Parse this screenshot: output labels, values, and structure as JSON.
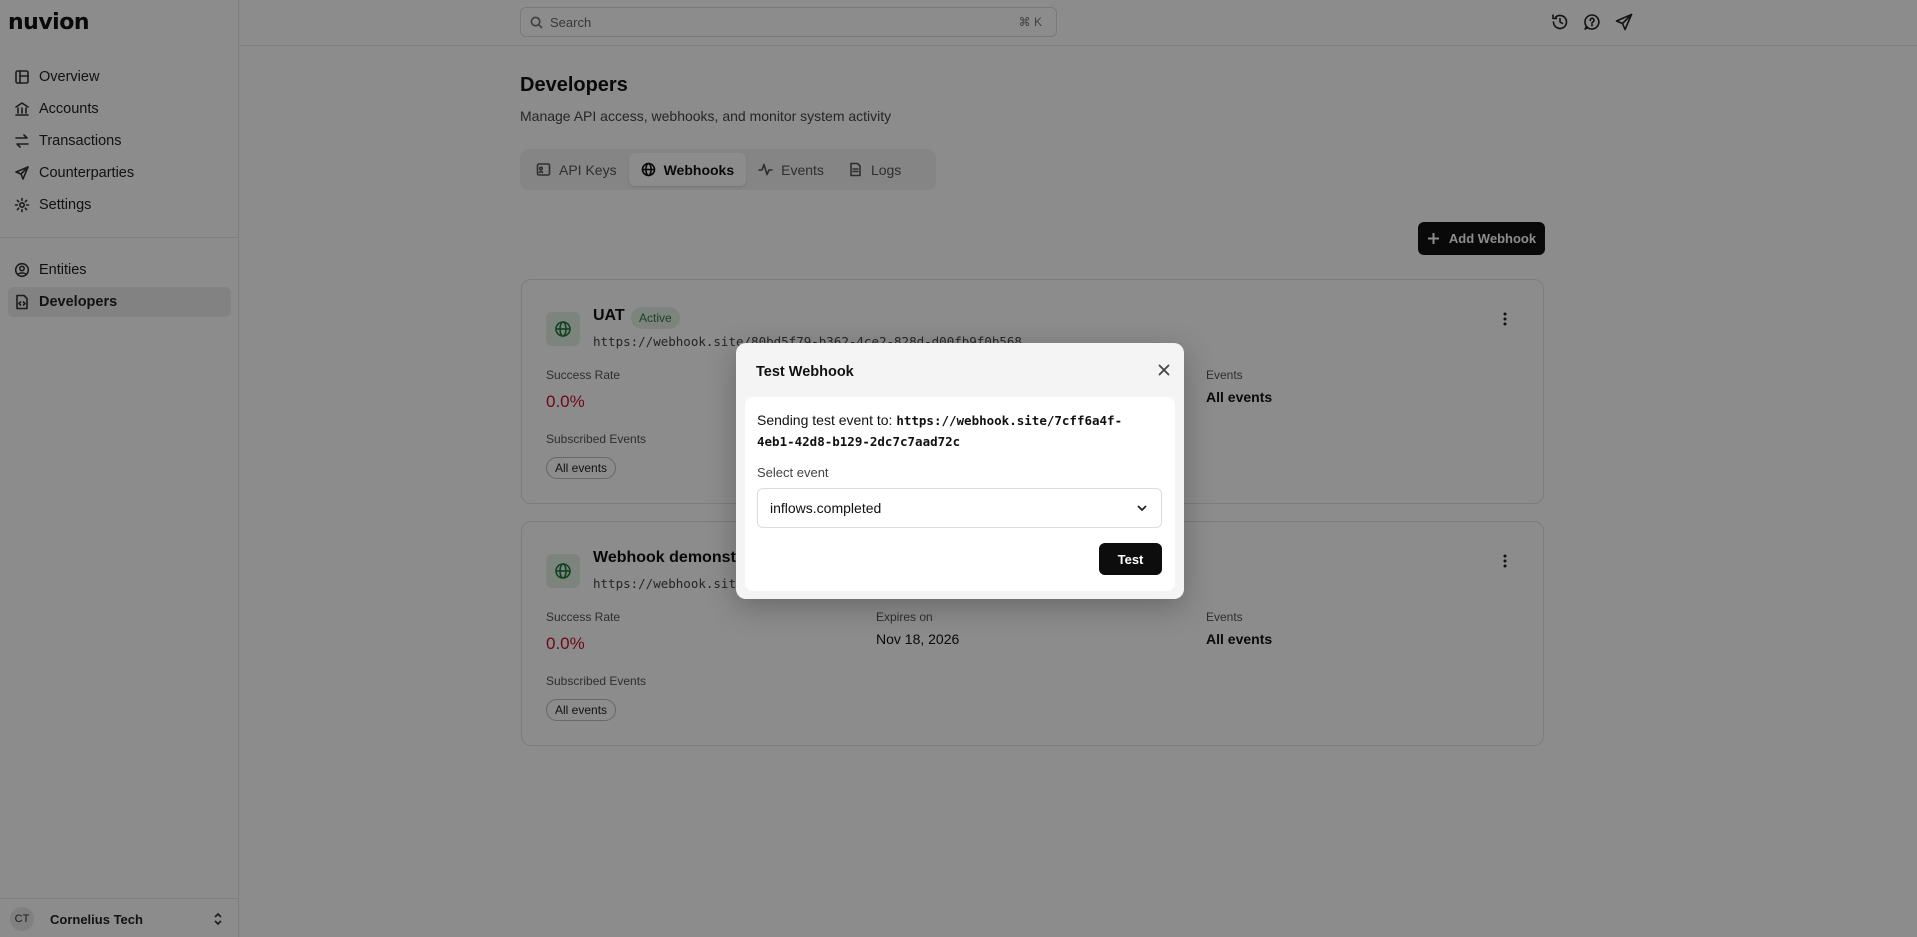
{
  "app": {
    "logo": "nuvion"
  },
  "sidebar": {
    "primary": [
      {
        "label": "Overview",
        "icon": "layout-icon"
      },
      {
        "label": "Accounts",
        "icon": "bank-icon"
      },
      {
        "label": "Transactions",
        "icon": "arrows-icon"
      },
      {
        "label": "Counterparties",
        "icon": "send-icon"
      },
      {
        "label": "Settings",
        "icon": "gear-icon"
      }
    ],
    "secondary": [
      {
        "label": "Entities",
        "icon": "user-circle-icon"
      },
      {
        "label": "Developers",
        "icon": "code-file-icon",
        "active": true
      }
    ],
    "account": {
      "initials": "CT",
      "name": "Cornelius Tech"
    }
  },
  "topbar": {
    "search_placeholder": "Search",
    "search_shortcut": "⌘ K"
  },
  "page": {
    "title": "Developers",
    "subtitle": "Manage API access, webhooks, and monitor system activity"
  },
  "tabs": [
    {
      "label": "API Keys"
    },
    {
      "label": "Webhooks",
      "active": true
    },
    {
      "label": "Events"
    },
    {
      "label": "Logs"
    }
  ],
  "add_button": "Add Webhook",
  "webhooks": [
    {
      "name": "UAT",
      "status": "Active",
      "url": "https://webhook.site/80bd5f79-b362-4ce2-828d-d00fb9f0b568",
      "success_rate_label": "Success Rate",
      "success_rate": "0.0%",
      "events_label": "Events",
      "events": "All events",
      "subscribed_label": "Subscribed Events",
      "subscribed": "All events"
    },
    {
      "name": "Webhook demonstr",
      "url": "https://webhook.sit",
      "success_rate_label": "Success Rate",
      "success_rate": "0.0%",
      "expires_label": "Expires on",
      "expires": "Nov 18, 2026",
      "events_label": "Events",
      "events": "All events",
      "subscribed_label": "Subscribed Events",
      "subscribed": "All events"
    }
  ],
  "modal": {
    "title": "Test Webhook",
    "sending_prefix": "Sending test event to: ",
    "target_url": "https://webhook.site/7cff6a4f-4eb1-42d8-b129-2dc7c7aad72c",
    "select_label": "Select event",
    "selected_event": "inflows.completed",
    "test_button": "Test"
  },
  "colors": {
    "accent": "#111111",
    "success_badge_bg": "#e3f1e6",
    "success_text": "#2c7a44",
    "danger": "#c8102e"
  }
}
